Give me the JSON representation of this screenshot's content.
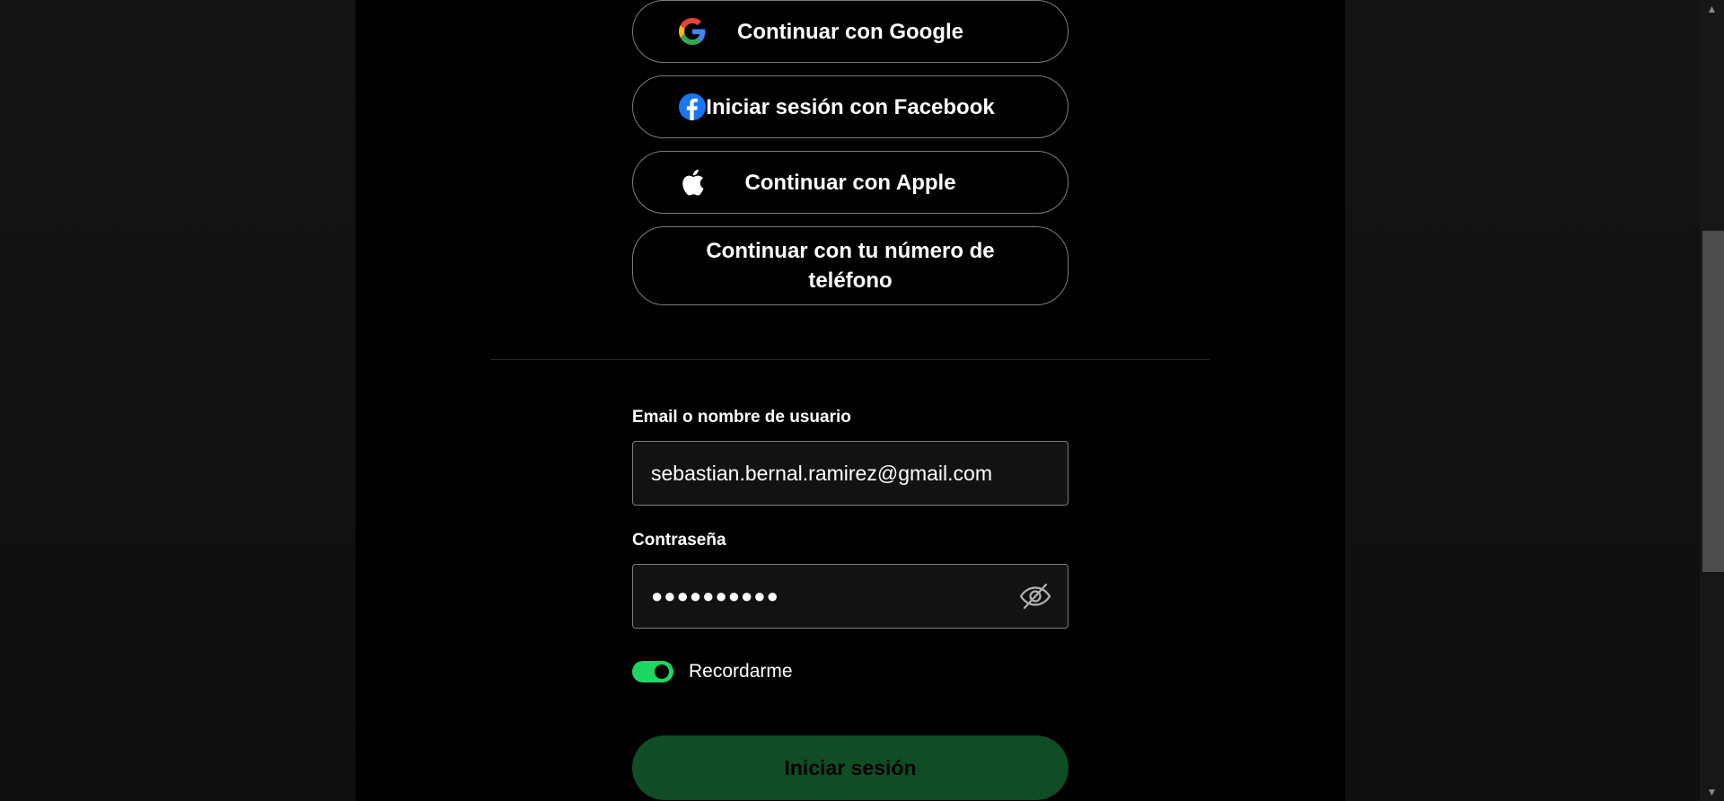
{
  "social_login": {
    "google": {
      "label": "Continuar con Google",
      "icon": "google-icon"
    },
    "facebook": {
      "label": "Iniciar sesión con Facebook",
      "icon": "facebook-icon"
    },
    "apple": {
      "label": "Continuar con Apple",
      "icon": "apple-icon"
    },
    "phone": {
      "label": "Continuar con tu número de teléfono"
    }
  },
  "form": {
    "email_label": "Email o nombre de usuario",
    "email_value": "sebastian.bernal.ramirez@gmail.com",
    "password_label": "Contraseña",
    "password_masked": "●●●●●●●●●●",
    "show_password_icon": "eye-slash-icon",
    "remember_label": "Recordarme",
    "remember_on": true,
    "submit_label": "Iniciar sesión"
  },
  "colors": {
    "accent": "#1ed760",
    "submit_bg": "#0f4d24",
    "card_bg": "#000000",
    "page_bg": "#121212"
  }
}
